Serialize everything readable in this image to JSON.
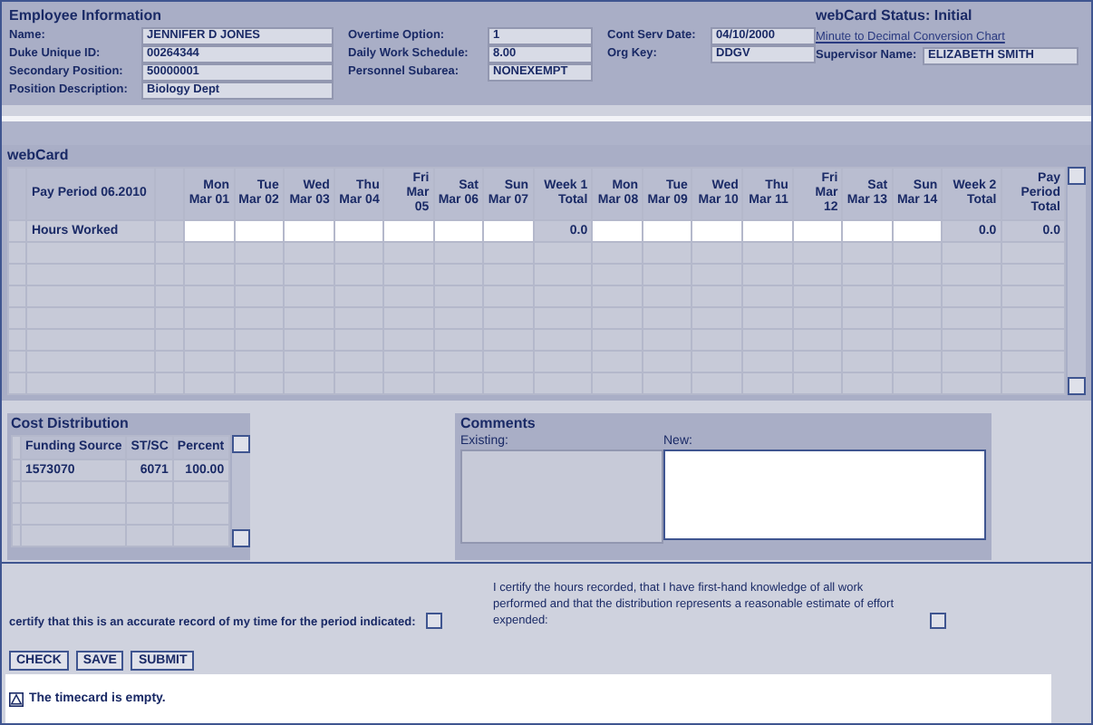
{
  "employee_info": {
    "title": "Employee Information",
    "columns": [
      [
        {
          "label": "Name:",
          "value": "JENNIFER D JONES"
        },
        {
          "label": "Duke Unique ID:",
          "value": "00264344"
        },
        {
          "label": "Secondary Position:",
          "value": "50000001"
        },
        {
          "label": "Position Description:",
          "value": "Biology Dept"
        }
      ],
      [
        {
          "label": "Overtime Option:",
          "value": "1"
        },
        {
          "label": "Daily Work Schedule:",
          "value": "8.00"
        },
        {
          "label": "Personnel Subarea:",
          "value": "NONEXEMPT"
        }
      ],
      [
        {
          "label": "Cont Serv Date:",
          "value": "04/10/2000"
        },
        {
          "label": "Org Key:",
          "value": "DDGV"
        }
      ]
    ],
    "status": "webCard Status: Initial",
    "link": "Minute to Decimal Conversion Chart",
    "supervisor": {
      "label": "Supervisor Name:",
      "value": "ELIZABETH SMITH"
    }
  },
  "webcard": {
    "title": "webCard",
    "period": "Pay Period 06.2010",
    "columns": [
      "Mon\nMar 01",
      "Tue\nMar 02",
      "Wed\nMar 03",
      "Thu\nMar 04",
      "Fri Mar\n05",
      "Sat\nMar 06",
      "Sun\nMar 07",
      "Week 1\nTotal",
      "Mon\nMar 08",
      "Tue\nMar 09",
      "Wed\nMar 10",
      "Thu\nMar 11",
      "Fri Mar\n12",
      "Sat\nMar 13",
      "Sun\nMar 14",
      "Week 2\nTotal",
      "Pay\nPeriod\nTotal"
    ],
    "rows": [
      {
        "label": "Hours Worked",
        "cells": [
          {
            "kind": "input"
          },
          {
            "kind": "input"
          },
          {
            "kind": "input"
          },
          {
            "kind": "input"
          },
          {
            "kind": "input"
          },
          {
            "kind": "input"
          },
          {
            "kind": "input"
          },
          {
            "kind": "total",
            "value": "0.0"
          },
          {
            "kind": "input"
          },
          {
            "kind": "input"
          },
          {
            "kind": "input"
          },
          {
            "kind": "input"
          },
          {
            "kind": "input"
          },
          {
            "kind": "input"
          },
          {
            "kind": "input"
          },
          {
            "kind": "total",
            "value": "0.0"
          },
          {
            "kind": "total",
            "value": "0.0"
          }
        ]
      }
    ]
  },
  "cost_distribution": {
    "title": "Cost Distribution",
    "columns": [
      "Funding Source",
      "ST/SC",
      "Percent"
    ],
    "rows": [
      [
        "1573070",
        "6071",
        "100.00"
      ]
    ]
  },
  "comments": {
    "title": "Comments",
    "existing_label": "Existing:",
    "new_label": "New:"
  },
  "certifications": [
    {
      "text": "certify that this is an accurate record of my time for the period indicated:",
      "checked": false
    },
    {
      "text": "I certify the hours recorded, that I have first-hand knowledge of all work performed and that the distribution represents a reasonable estimate of effort expended:",
      "checked": false
    }
  ],
  "buttons": [
    "CHECK",
    "SAVE",
    "SUBMIT"
  ],
  "message": "The timecard is empty."
}
